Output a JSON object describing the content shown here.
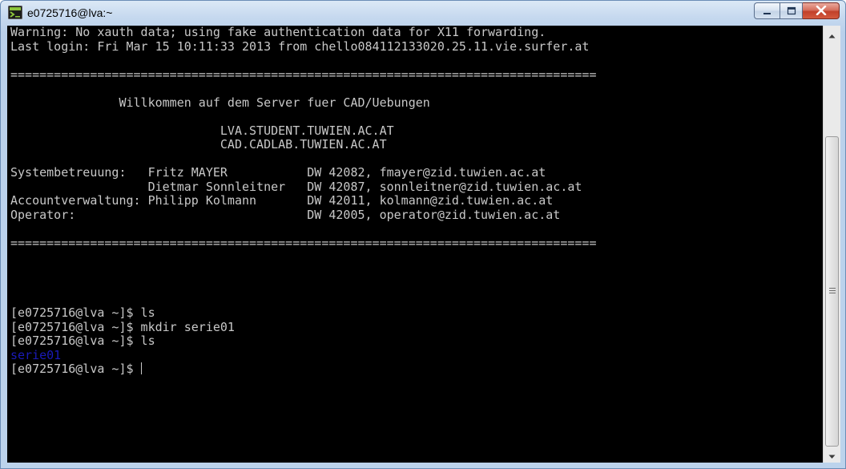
{
  "window": {
    "title": "e0725716@lva:~",
    "icon": "terminal-icon",
    "controls": {
      "minimize_icon": "minimize-icon",
      "maximize_icon": "maximize-icon",
      "close_icon": "close-icon"
    }
  },
  "terminal": {
    "lines": [
      "Warning: No xauth data; using fake authentication data for X11 forwarding.",
      "Last login: Fri Mar 15 10:11:33 2013 from chello084112133020.25.11.vie.surfer.at",
      "",
      "=================================================================================",
      "",
      "               Willkommen auf dem Server fuer CAD/Uebungen",
      "",
      "                             LVA.STUDENT.TUWIEN.AC.AT",
      "                             CAD.CADLAB.TUWIEN.AC.AT",
      "",
      "Systembetreuung:   Fritz MAYER           DW 42082, fmayer@zid.tuwien.ac.at",
      "                   Dietmar Sonnleitner   DW 42087, sonnleitner@zid.tuwien.ac.at",
      "Accountverwaltung: Philipp Kolmann       DW 42011, kolmann@zid.tuwien.ac.at",
      "Operator:                                DW 42005, operator@zid.tuwien.ac.at",
      "",
      "=================================================================================",
      "",
      "",
      "",
      "",
      "[e0725716@lva ~]$ ls",
      "[e0725716@lva ~]$ mkdir serie01",
      "[e0725716@lva ~]$ ls"
    ],
    "dir_listing": "serie01",
    "prompt": "[e0725716@lva ~]$ "
  },
  "colors": {
    "background": "#000000",
    "text": "#c8c8c8",
    "directory": "#1a1ab8"
  }
}
